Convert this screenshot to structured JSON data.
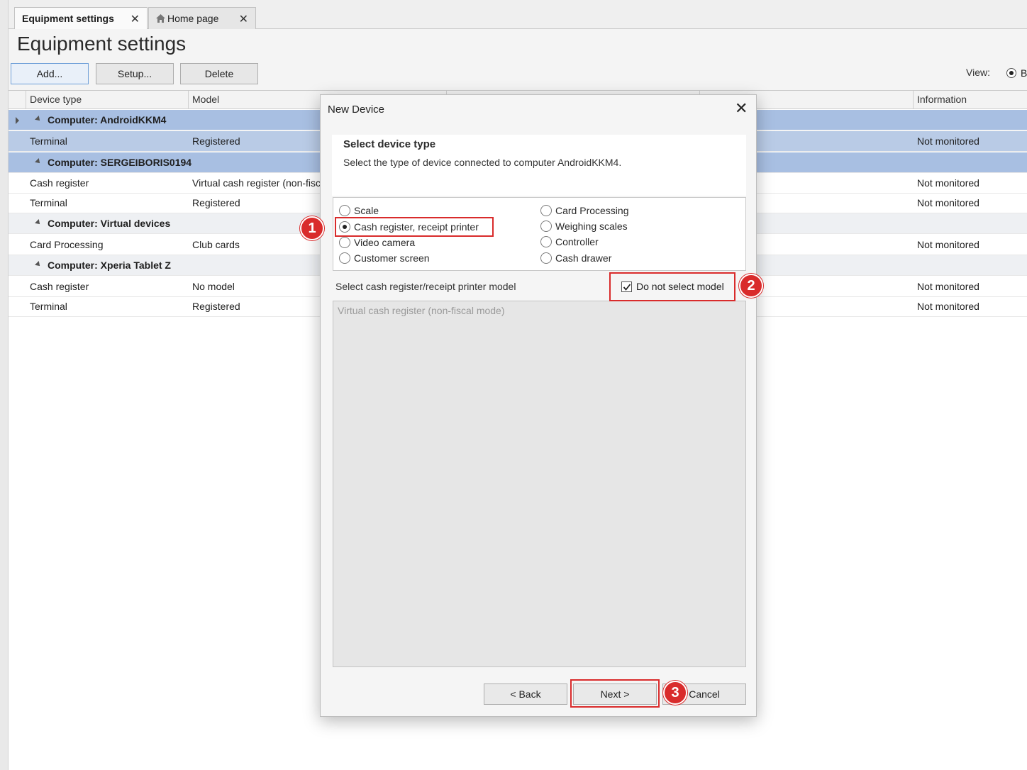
{
  "tabs": [
    {
      "label": "Equipment settings",
      "active": true
    },
    {
      "label": "Home page",
      "active": false
    }
  ],
  "page_title": "Equipment settings",
  "toolbar": {
    "add_label": "Add...",
    "setup_label": "Setup...",
    "delete_label": "Delete"
  },
  "view": {
    "label": "View:",
    "option_visible": "B"
  },
  "grid": {
    "columns": [
      "Device type",
      "Model",
      "Information"
    ],
    "rows": [
      {
        "type": "group",
        "label": "Computer: AndroidKKM4"
      },
      {
        "type": "row",
        "device": "Terminal",
        "model": "Registered",
        "info": "Not monitored"
      },
      {
        "type": "group",
        "label": "Computer: SERGEIBORIS0194"
      },
      {
        "type": "row",
        "device": "Cash register",
        "model": "Virtual cash register (non-fisc",
        "info": "Not monitored"
      },
      {
        "type": "row",
        "device": "Terminal",
        "model": "Registered",
        "info": "Not monitored"
      },
      {
        "type": "group",
        "label": "Computer: Virtual devices"
      },
      {
        "type": "row",
        "device": "Card Processing",
        "model": "Club cards",
        "info": "Not monitored"
      },
      {
        "type": "group",
        "label": "Computer: Xperia Tablet Z"
      },
      {
        "type": "row",
        "device": "Cash register",
        "model": "No model",
        "info": "Not monitored"
      },
      {
        "type": "row",
        "device": "Terminal",
        "model": "Registered",
        "info": "Not monitored"
      }
    ]
  },
  "dialog": {
    "title": "New Device",
    "heading": "Select device type",
    "subheading": "Select the type of device connected to computer AndroidKKM4.",
    "options_left": [
      "Scale",
      "Cash register, receipt printer",
      "Video camera",
      "Customer screen"
    ],
    "options_right": [
      "Card Processing",
      "Weighing scales",
      "Controller",
      "Cash drawer"
    ],
    "selected_option": "Cash register, receipt printer",
    "model_label": "Select cash register/receipt printer model",
    "do_not_select_label": "Do not select model",
    "do_not_select_checked": true,
    "model_list": [
      "Virtual cash register (non-fiscal mode)"
    ],
    "back_label": "< Back",
    "next_label": "Next >",
    "cancel_label": "Cancel"
  },
  "annotations": {
    "badge1": "1",
    "badge2": "2",
    "badge3": "3",
    "color": "#d92b2b"
  }
}
